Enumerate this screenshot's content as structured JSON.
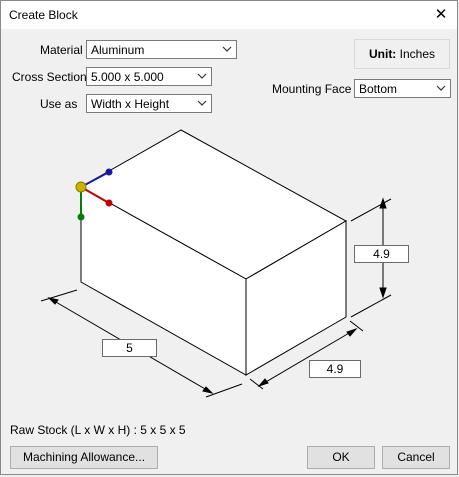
{
  "window": {
    "title": "Create Block"
  },
  "fields": {
    "material": {
      "label": "Material",
      "value": "Aluminum"
    },
    "cross_section": {
      "label": "Cross Section",
      "value": "5.000 x 5.000"
    },
    "use_as": {
      "label": "Use as",
      "value": "Width x Height"
    },
    "mounting_face": {
      "label": "Mounting Face",
      "value": "Bottom"
    }
  },
  "units": {
    "label": "Unit:",
    "value": "Inches"
  },
  "dimensions": {
    "length": "5",
    "width": "4.9",
    "height": "4.9"
  },
  "raw_stock": "Raw Stock (L x W x H) :  5 x 5 x 5",
  "buttons": {
    "machining": "Machining Allowance...",
    "ok": "OK",
    "cancel": "Cancel"
  },
  "icons": {
    "close": "close-icon",
    "chevron": "chevron-down-icon"
  },
  "colors": {
    "axis_x": "#c00000",
    "axis_y": "#1a1aa0",
    "axis_z": "#0a7a0a",
    "origin": "#c8b400"
  }
}
